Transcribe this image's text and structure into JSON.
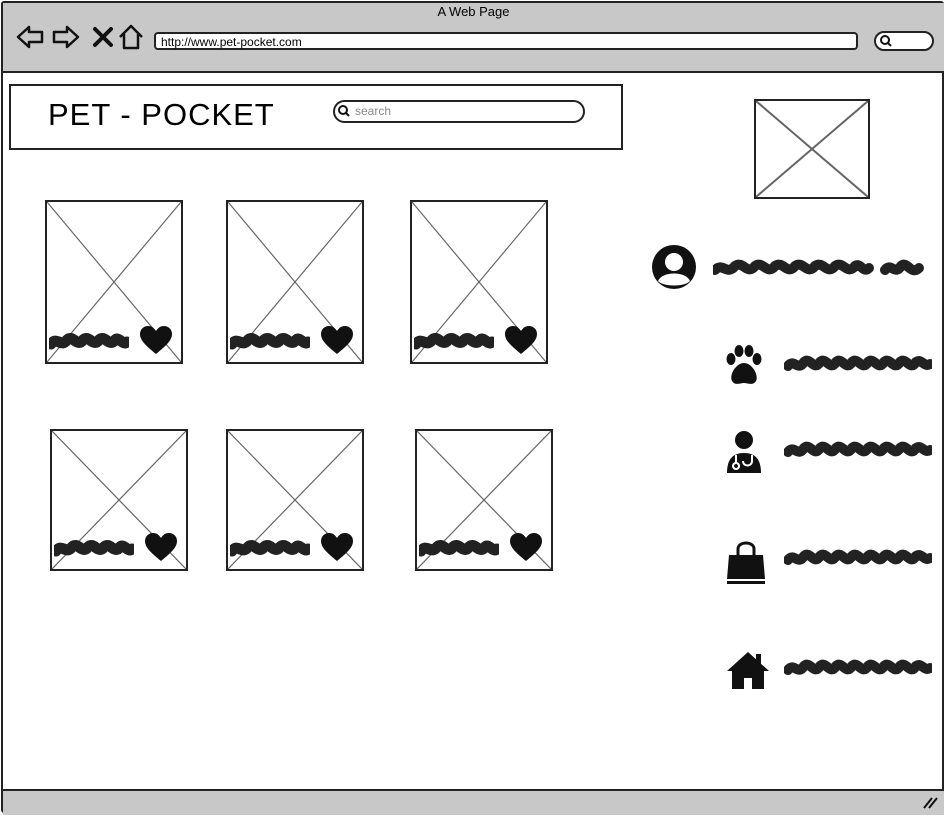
{
  "browser": {
    "title": "A Web Page",
    "url": "http://www.pet-pocket.com"
  },
  "header": {
    "logo": "PET - POCKET",
    "search_placeholder": "search"
  },
  "icons": {
    "back": "back-arrow-icon",
    "forward": "forward-arrow-icon",
    "stop": "close-icon",
    "home": "home-icon",
    "search": "search-icon",
    "favorite": "heart-icon",
    "profile": "user-avatar-icon",
    "pets": "paw-icon",
    "vet": "doctor-icon",
    "shop": "shopping-bag-icon",
    "house": "house-icon"
  },
  "grid": {
    "rows": 2,
    "columns": 3,
    "cards": [
      {
        "id": 1,
        "favorite": true
      },
      {
        "id": 2,
        "favorite": true
      },
      {
        "id": 3,
        "favorite": true
      },
      {
        "id": 4,
        "favorite": true
      },
      {
        "id": 5,
        "favorite": true
      },
      {
        "id": 6,
        "favorite": true
      }
    ]
  },
  "sidebar": {
    "menu": [
      {
        "icon": "paw-icon"
      },
      {
        "icon": "doctor-icon"
      },
      {
        "icon": "shopping-bag-icon"
      },
      {
        "icon": "house-icon"
      }
    ]
  }
}
